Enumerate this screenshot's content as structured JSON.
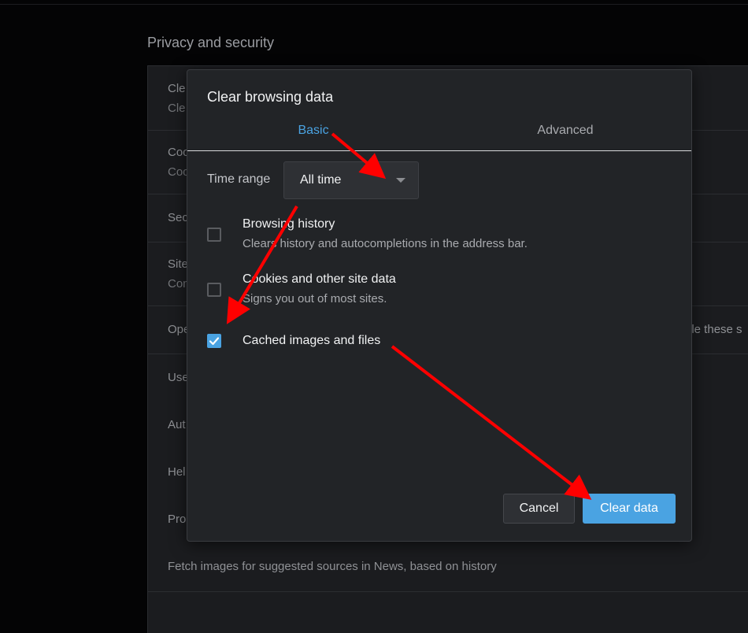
{
  "background": {
    "section_title": "Privacy and security",
    "rows": [
      {
        "title": "Cle",
        "subtitle": "Cle"
      },
      {
        "title": "Coo",
        "subtitle": "Coo"
      },
      {
        "title": "Sec"
      },
      {
        "title": "Site",
        "subtitle": "Con"
      },
      {
        "title": "Ope",
        "right": "ble these s"
      },
      {
        "title": "Use"
      },
      {
        "title": "Aut"
      },
      {
        "title": "Hel"
      },
      {
        "title": "Pro"
      },
      {
        "title": "Fetch images for suggested sources in News, based on history"
      }
    ]
  },
  "dialog": {
    "title": "Clear browsing data",
    "tabs": {
      "basic": "Basic",
      "advanced": "Advanced"
    },
    "time_range": {
      "label": "Time range",
      "value": "All time"
    },
    "items": [
      {
        "title": "Browsing history",
        "description": "Clears history and autocompletions in the address bar.",
        "checked": false
      },
      {
        "title": "Cookies and other site data",
        "description": "Signs you out of most sites.",
        "checked": false
      },
      {
        "title": "Cached images and files",
        "checked": true
      }
    ],
    "buttons": {
      "cancel": "Cancel",
      "clear": "Clear data"
    }
  },
  "colors": {
    "accent": "#4aa3e2",
    "annotation_arrow": "#ff0000"
  }
}
